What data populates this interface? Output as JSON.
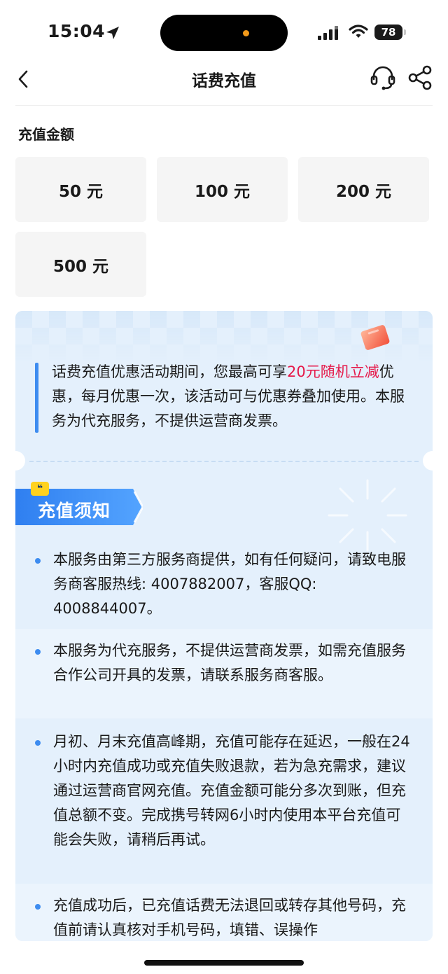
{
  "status_bar": {
    "time": "15:04",
    "battery": "78",
    "icons": [
      "location-arrow-icon",
      "signal-icon",
      "wifi-icon",
      "battery-icon"
    ],
    "island_dot_color": "#f29a1a"
  },
  "nav": {
    "title": "话费充值",
    "back_icon": "chevron-left-icon",
    "support_icon": "headset-icon",
    "share_icon": "share-icon"
  },
  "amount": {
    "label": "充值金额",
    "options": [
      "50 元",
      "100 元",
      "200 元",
      "500 元"
    ]
  },
  "promo": {
    "text_before": "话费充值优惠活动期间，您最高可享",
    "highlight": "20元随机立减",
    "text_after": "优惠，每月优惠一次，该活动可与优惠券叠加使用。本服务为代充服务，不提供运营商发票。",
    "highlight_color": "#e5194a",
    "accent_color": "#3d8cf0",
    "icon": "gift-icon"
  },
  "notice": {
    "badge": "❝",
    "title": "充值须知",
    "items": [
      "本服务由第三方服务商提供，如有任何疑问，请致电服务商客服热线: 4007882007，客服QQ: 4008844007。",
      "本服务为代充服务，不提供运营商发票，如需充值服务合作公司开具的发票，请联系服务商客服。",
      "月初、月末充值高峰期，充值可能存在延迟，一般在24小时内充值成功或充值失败退款，若为急充需求，建议通过运营商官网充值。充值金额可能分多次到账，但充值总额不变。完成携号转网6小时内使用本平台充值可能会失败，请稍后再试。",
      "充值成功后，已充值话费无法退回或转存其他号码，充值前请认真核对手机号码，填错、误操作"
    ]
  }
}
